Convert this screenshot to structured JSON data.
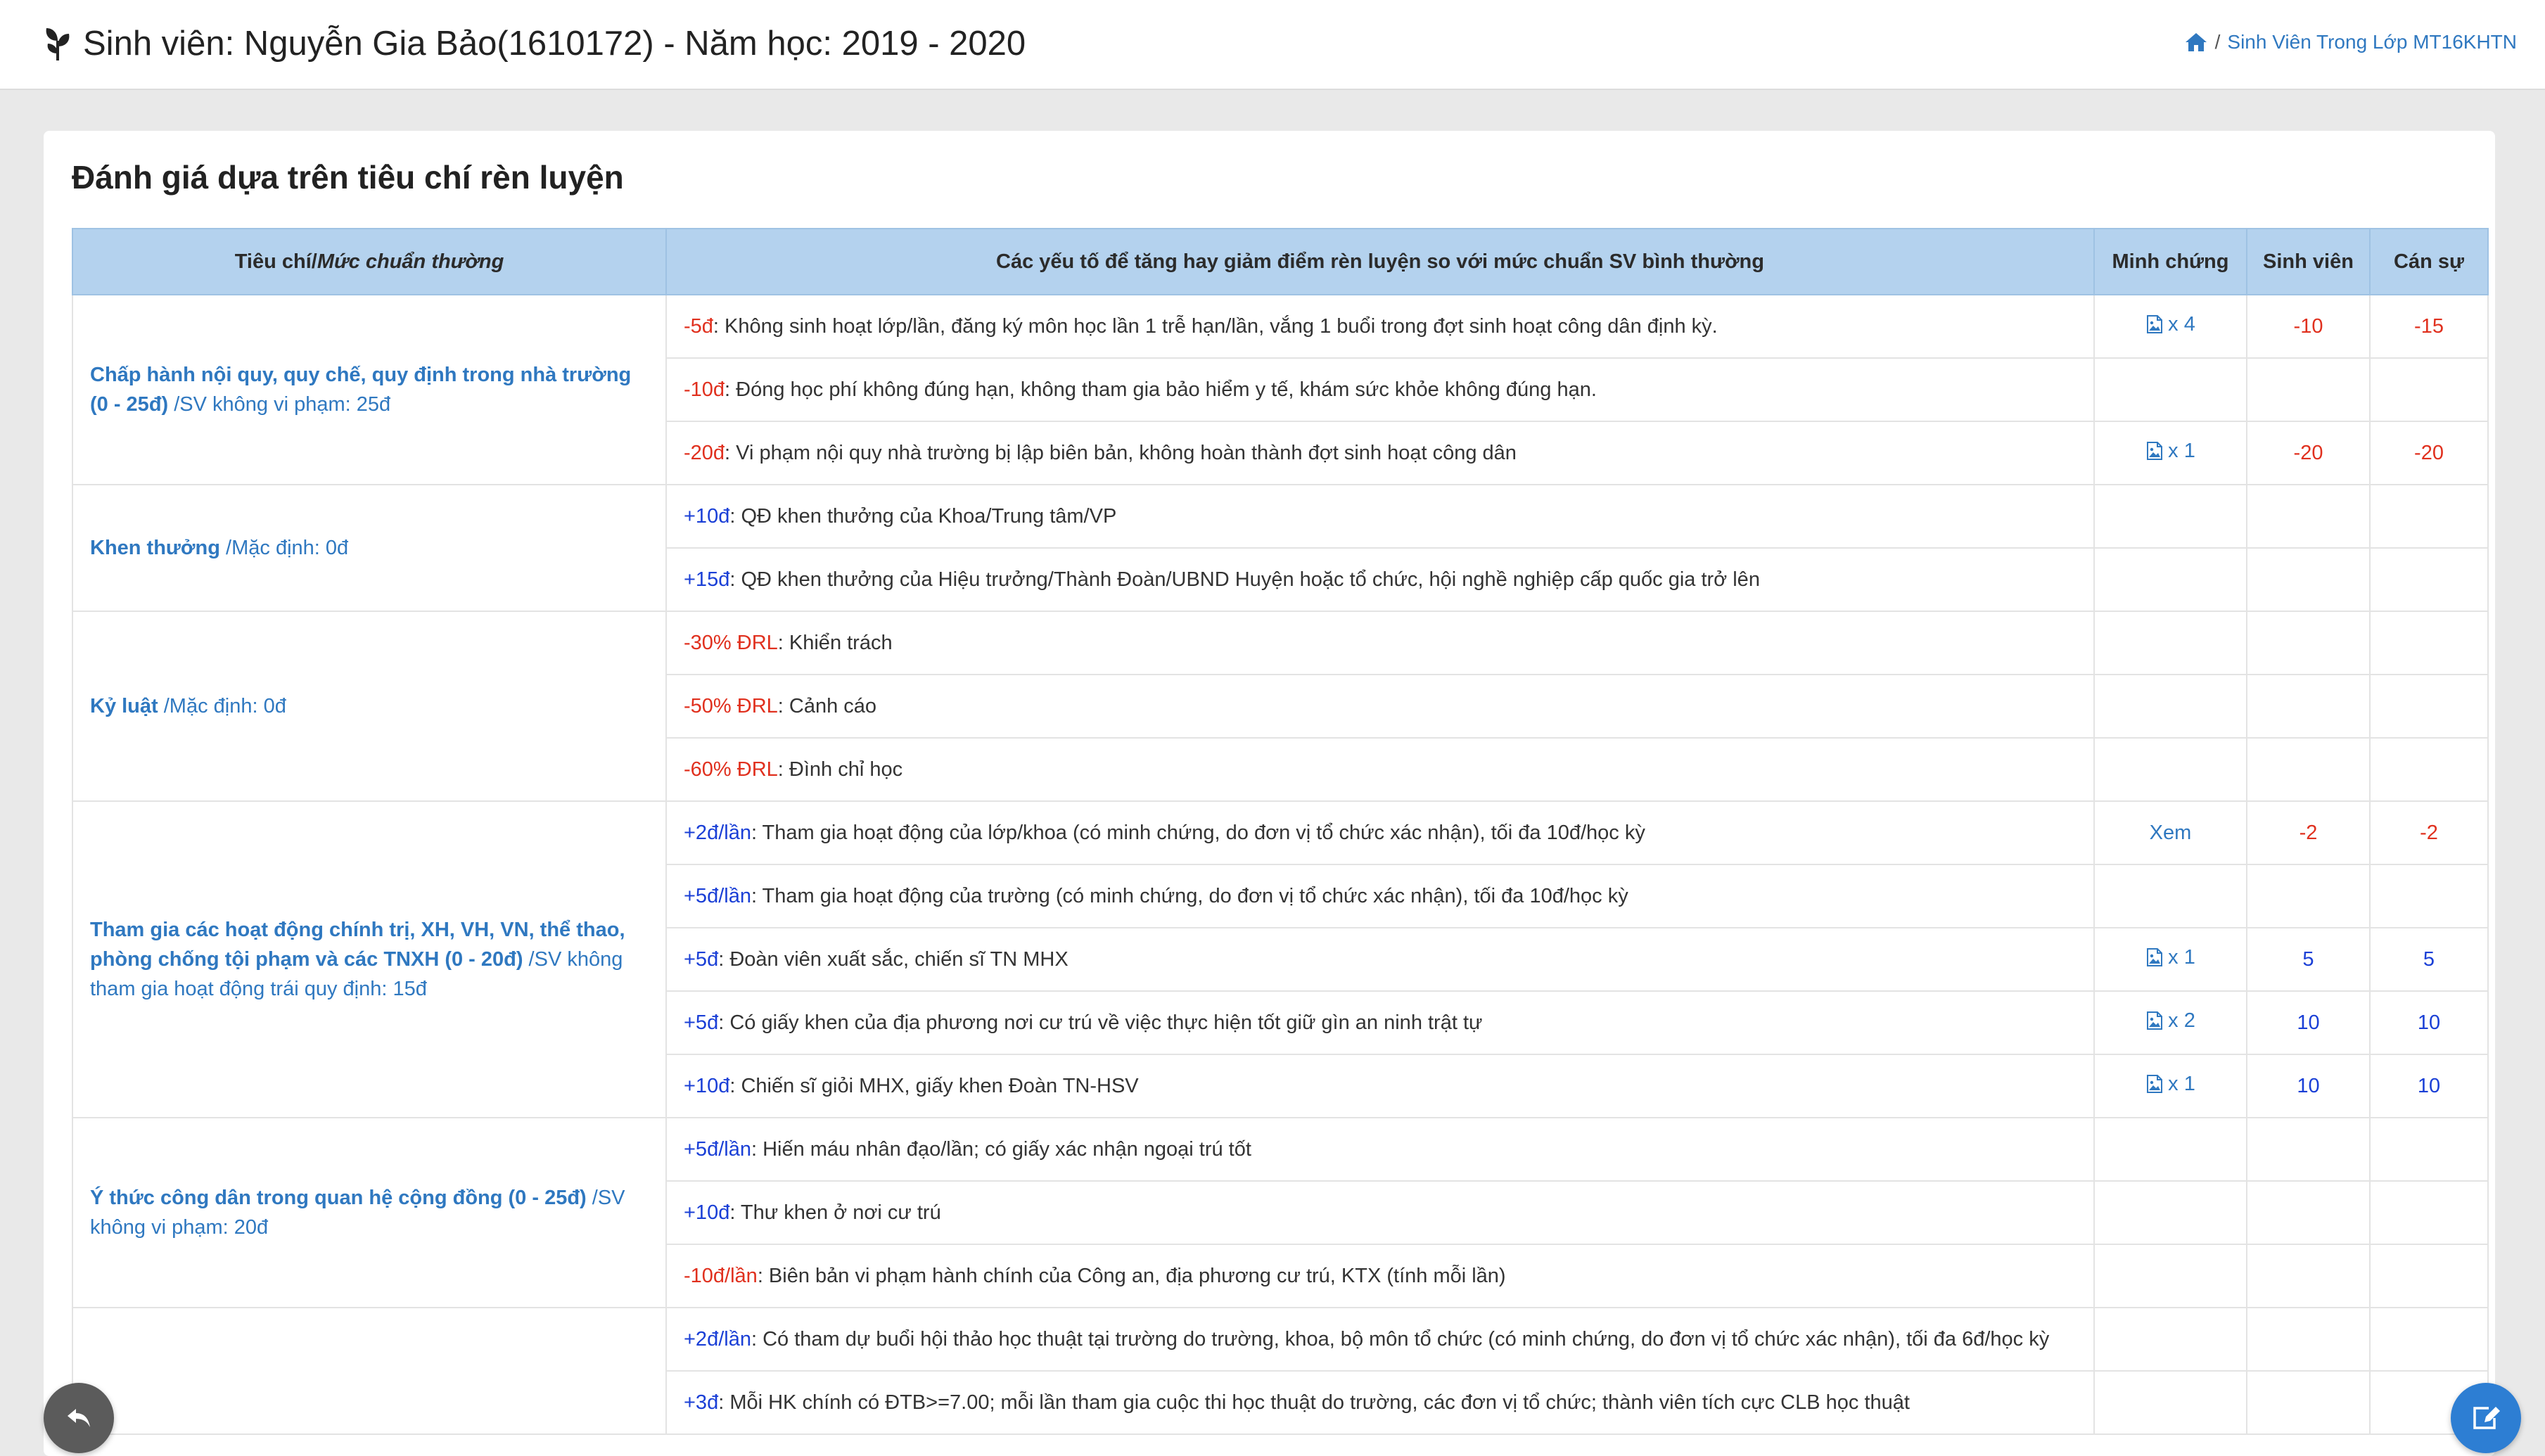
{
  "header": {
    "title": "Sinh viên: Nguyễn Gia Bảo(1610172) - Năm học: 2019 - 2020",
    "breadcrumb": "Sinh Viên Trong Lớp MT16KHTN",
    "breadcrumb_separator": "/"
  },
  "panel": {
    "heading": "Đánh giá dựa trên tiêu chí rèn luyện"
  },
  "table": {
    "headers": {
      "criteria_prefix": "Tiêu chí/",
      "criteria_italic": "Mức chuẩn thường",
      "factors": "Các yếu tố để tăng hay giảm điểm rèn luyện so với mức chuẩn SV bình thường",
      "evidence": "Minh chứng",
      "student": "Sinh viên",
      "officer": "Cán sự"
    },
    "groups": [
      {
        "title": "Chấp hành nội quy, quy chế, quy định trong nhà trường (0 - 25đ)",
        "note": " /SV không vi phạm: 25đ",
        "rows": [
          {
            "points": "-5đ",
            "text": ": Không sinh hoạt lớp/lần, đăng ký môn học lần 1 trễ hạn/lần, vắng 1 buổi trong đợt sinh hoạt công dân định kỳ.",
            "evidence": "x 4",
            "student": "-10",
            "officer": "-15"
          },
          {
            "points": "-10đ",
            "text": ": Đóng học phí không đúng hạn, không tham gia bảo hiểm y tế, khám sức khỏe không đúng hạn.",
            "evidence": "",
            "student": "",
            "officer": ""
          },
          {
            "points": "-20đ",
            "text": ": Vi phạm nội quy nhà trường bị lập biên bản, không hoàn thành đợt sinh hoạt công dân",
            "evidence": "x 1",
            "student": "-20",
            "officer": "-20"
          }
        ]
      },
      {
        "title": "Khen thưởng",
        "note": " /Mặc định: 0đ",
        "rows": [
          {
            "points": "+10đ",
            "text": ": QĐ khen thưởng của Khoa/Trung tâm/VP",
            "evidence": "",
            "student": "",
            "officer": ""
          },
          {
            "points": "+15đ",
            "text": ": QĐ khen thưởng của Hiệu trưởng/Thành Đoàn/UBND Huyện hoặc tổ chức, hội nghề nghiệp cấp quốc gia trở lên",
            "evidence": "",
            "student": "",
            "officer": ""
          }
        ]
      },
      {
        "title": "Kỷ luật",
        "note": " /Mặc định: 0đ",
        "rows": [
          {
            "points": "-30% ĐRL",
            "text": ": Khiển trách",
            "evidence": "",
            "student": "",
            "officer": ""
          },
          {
            "points": "-50% ĐRL",
            "text": ": Cảnh cáo",
            "evidence": "",
            "student": "",
            "officer": ""
          },
          {
            "points": "-60% ĐRL",
            "text": ": Đình chỉ học",
            "evidence": "",
            "student": "",
            "officer": ""
          }
        ]
      },
      {
        "title": "Tham gia các hoạt động chính trị, XH, VH, VN, thể thao, phòng chống tội phạm và các TNXH (0 - 20đ)",
        "note": " /SV không tham gia hoạt động trái quy định: 15đ",
        "rows": [
          {
            "points": "+2đ/lần",
            "text": ": Tham gia hoạt động của lớp/khoa (có minh chứng, do đơn vị tổ chức xác nhận), tối đa 10đ/học kỳ",
            "evidence": "Xem",
            "student": "-2",
            "officer": "-2"
          },
          {
            "points": "+5đ/lần",
            "text": ": Tham gia hoạt động của trường (có minh chứng, do đơn vị tổ chức xác nhận), tối đa 10đ/học kỳ",
            "evidence": "",
            "student": "",
            "officer": ""
          },
          {
            "points": "+5đ",
            "text": ": Đoàn viên xuất sắc, chiến sĩ TN MHX",
            "evidence": "x 1",
            "student": "5",
            "officer": "5"
          },
          {
            "points": "+5đ",
            "text": ": Có giấy khen của địa phương nơi cư trú về việc thực hiện tốt giữ gìn an ninh trật tự",
            "evidence": "x 2",
            "student": "10",
            "officer": "10"
          },
          {
            "points": "+10đ",
            "text": ": Chiến sĩ giỏi MHX, giấy khen Đoàn TN-HSV",
            "evidence": "x 1",
            "student": "10",
            "officer": "10"
          }
        ]
      },
      {
        "title": "Ý thức công dân trong quan hệ cộng đồng (0 - 25đ)",
        "note": " /SV không vi phạm: 20đ",
        "rows": [
          {
            "points": "+5đ/lần",
            "text": ": Hiến máu nhân đạo/lần; có giấy xác nhận ngoại trú tốt",
            "evidence": "",
            "student": "",
            "officer": ""
          },
          {
            "points": "+10đ",
            "text": ": Thư khen ở nơi cư trú",
            "evidence": "",
            "student": "",
            "officer": ""
          },
          {
            "points": "-10đ/lần",
            "text": ": Biên bản vi phạm hành chính của Công an, địa phương cư trú, KTX (tính mỗi lần)",
            "evidence": "",
            "student": "",
            "officer": ""
          }
        ]
      },
      {
        "title": "",
        "note": "",
        "rows": [
          {
            "points": "+2đ/lần",
            "text": ": Có tham dự buổi hội thảo học thuật tại trường do trường, khoa, bộ môn tổ chức (có minh chứng, do đơn vị tổ chức xác nhận), tối đa 6đ/học kỳ",
            "evidence": "",
            "student": "",
            "officer": ""
          },
          {
            "points": "+3đ",
            "text": ": Mỗi HK chính có ĐTB>=7.00; mỗi lần tham gia cuộc thi học thuật do trường, các đơn vị tổ chức; thành viên tích cực CLB học thuật",
            "evidence": "",
            "student": "",
            "officer": ""
          }
        ]
      }
    ]
  },
  "icons": {
    "title": "leaf-icon",
    "home": "home-icon",
    "evidence": "image-file-icon",
    "back": "reply-icon",
    "edit": "edit-icon"
  },
  "colors": {
    "accent": "#2f78c0",
    "header_bg": "#b4d2ee",
    "penalty": "#e0301e",
    "bonus": "#1a3fd6",
    "edit_button": "#2d7ed3",
    "back_button": "#5b5b5b"
  }
}
